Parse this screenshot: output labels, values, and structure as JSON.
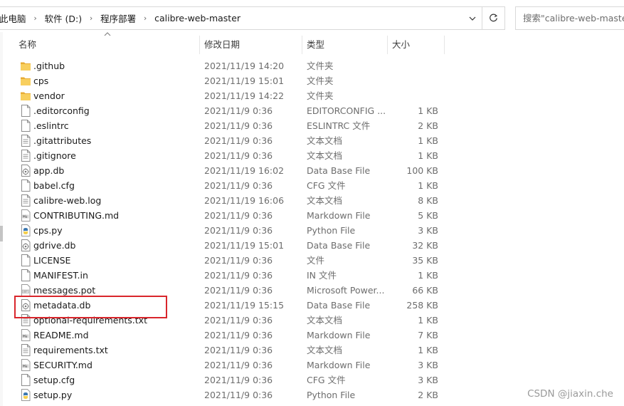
{
  "address": {
    "crumbs": [
      "此电脑",
      "软件 (D:)",
      "程序部署",
      "calibre-web-master"
    ]
  },
  "search": {
    "placeholder": "搜索\"calibre-web-master\""
  },
  "columns": {
    "name": "名称",
    "date": "修改日期",
    "type": "类型",
    "size": "大小"
  },
  "files": [
    {
      "name": ".github",
      "date": "2021/11/19 14:20",
      "type": "文件夹",
      "size": "",
      "icon": "folder-icon"
    },
    {
      "name": "cps",
      "date": "2021/11/19 15:01",
      "type": "文件夹",
      "size": "",
      "icon": "folder-icon"
    },
    {
      "name": "vendor",
      "date": "2021/11/19 14:22",
      "type": "文件夹",
      "size": "",
      "icon": "folder-icon"
    },
    {
      "name": ".editorconfig",
      "date": "2021/11/9 0:36",
      "type": "EDITORCONFIG ...",
      "size": "1 KB",
      "icon": "file-icon"
    },
    {
      "name": ".eslintrc",
      "date": "2021/11/9 0:36",
      "type": "ESLINTRC 文件",
      "size": "2 KB",
      "icon": "file-icon"
    },
    {
      "name": ".gitattributes",
      "date": "2021/11/9 0:36",
      "type": "文本文档",
      "size": "1 KB",
      "icon": "text-file-icon"
    },
    {
      "name": ".gitignore",
      "date": "2021/11/9 0:36",
      "type": "文本文档",
      "size": "1 KB",
      "icon": "text-file-icon"
    },
    {
      "name": "app.db",
      "date": "2021/11/19 16:02",
      "type": "Data Base File",
      "size": "100 KB",
      "icon": "database-file-icon"
    },
    {
      "name": "babel.cfg",
      "date": "2021/11/9 0:36",
      "type": "CFG 文件",
      "size": "1 KB",
      "icon": "file-icon"
    },
    {
      "name": "calibre-web.log",
      "date": "2021/11/19 16:06",
      "type": "文本文档",
      "size": "8 KB",
      "icon": "text-file-icon"
    },
    {
      "name": "CONTRIBUTING.md",
      "date": "2021/11/9 0:36",
      "type": "Markdown File",
      "size": "5 KB",
      "icon": "markdown-file-icon"
    },
    {
      "name": "cps.py",
      "date": "2021/11/9 0:36",
      "type": "Python File",
      "size": "3 KB",
      "icon": "python-file-icon"
    },
    {
      "name": "gdrive.db",
      "date": "2021/11/19 15:01",
      "type": "Data Base File",
      "size": "32 KB",
      "icon": "database-file-icon"
    },
    {
      "name": "LICENSE",
      "date": "2021/11/9 0:36",
      "type": "文件",
      "size": "35 KB",
      "icon": "file-icon"
    },
    {
      "name": "MANIFEST.in",
      "date": "2021/11/9 0:36",
      "type": "IN 文件",
      "size": "1 KB",
      "icon": "file-icon"
    },
    {
      "name": "messages.pot",
      "date": "2021/11/9 0:36",
      "type": "Microsoft Power...",
      "size": "66 KB",
      "icon": "powerpoint-file-icon"
    },
    {
      "name": "metadata.db",
      "date": "2021/11/19 15:15",
      "type": "Data Base File",
      "size": "258 KB",
      "icon": "database-file-icon"
    },
    {
      "name": "optional-requirements.txt",
      "date": "2021/11/9 0:36",
      "type": "文本文档",
      "size": "1 KB",
      "icon": "text-file-icon"
    },
    {
      "name": "README.md",
      "date": "2021/11/9 0:36",
      "type": "Markdown File",
      "size": "7 KB",
      "icon": "markdown-file-icon"
    },
    {
      "name": "requirements.txt",
      "date": "2021/11/9 0:36",
      "type": "文本文档",
      "size": "1 KB",
      "icon": "text-file-icon"
    },
    {
      "name": "SECURITY.md",
      "date": "2021/11/9 0:36",
      "type": "Markdown File",
      "size": "3 KB",
      "icon": "markdown-file-icon"
    },
    {
      "name": "setup.cfg",
      "date": "2021/11/9 0:36",
      "type": "CFG 文件",
      "size": "3 KB",
      "icon": "file-icon"
    },
    {
      "name": "setup.py",
      "date": "2021/11/9 0:36",
      "type": "Python File",
      "size": "2 KB",
      "icon": "python-file-icon"
    }
  ],
  "watermark": "CSDN @jiaxin.che",
  "colors": {
    "folder": "#f3c24e",
    "highlight": "#d9262c",
    "python_blue": "#3c78b0",
    "python_yellow": "#f6d04d"
  }
}
